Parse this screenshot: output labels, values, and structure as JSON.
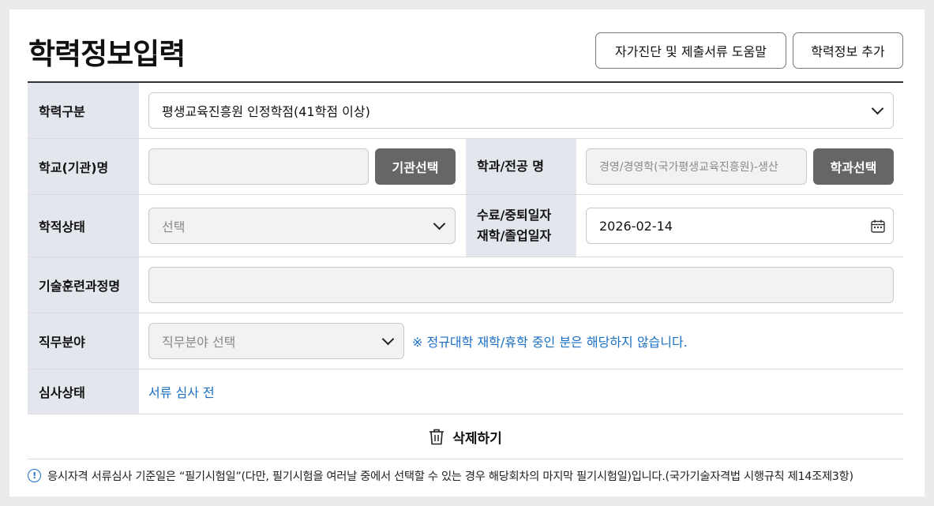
{
  "page": {
    "title": "학력정보입력",
    "help_button": "자가진단 및 제출서류 도움말",
    "add_button": "학력정보 추가"
  },
  "form": {
    "edu_type": {
      "label": "학력구분",
      "value": "평생교육진흥원 인정학점(41학점 이상)"
    },
    "school": {
      "label": "학교(기관)명",
      "value": "",
      "button": "기관선택"
    },
    "major": {
      "label": "학과/전공 명",
      "placeholder": "경영/경영학(국가평생교육진흥원)-생산",
      "button": "학과선택"
    },
    "status": {
      "label": "학적상태",
      "placeholder": "선택"
    },
    "date": {
      "label_line1": "수료/중퇴일자",
      "label_line2": "재학/졸업일자",
      "value": "2026-02-14"
    },
    "course": {
      "label": "기술훈련과정명",
      "value": ""
    },
    "job_field": {
      "label": "직무분야",
      "placeholder": "직무분야 선택",
      "note": "※ 정규대학 재학/휴학 중인 분은 해당하지 않습니다."
    },
    "review": {
      "label": "심사상태",
      "value": "서류 심사 전"
    }
  },
  "delete_label": "삭제하기",
  "footnote": "응시자격 서류심사 기준일은 “필기시험일”(다만, 필기시험을 여러날 중에서 선택할 수 있는 경우 해당회차의 마지막 필기시험일)입니다.(국가기술자격법 시행규칙 제14조제3항)",
  "colors": {
    "accent": "#1a6fc4",
    "header_bg": "#e3e6ec",
    "button_dark": "#666666"
  }
}
